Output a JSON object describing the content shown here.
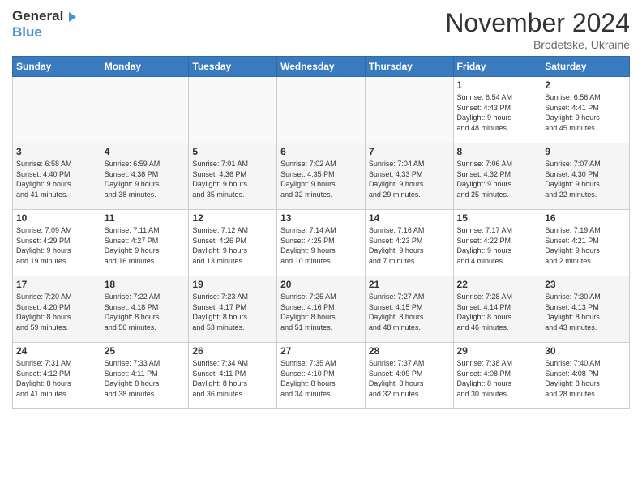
{
  "header": {
    "logo_line1": "General",
    "logo_line2": "Blue",
    "month_title": "November 2024",
    "location": "Brodetske, Ukraine"
  },
  "weekdays": [
    "Sunday",
    "Monday",
    "Tuesday",
    "Wednesday",
    "Thursday",
    "Friday",
    "Saturday"
  ],
  "weeks": [
    [
      {
        "day": "",
        "info": ""
      },
      {
        "day": "",
        "info": ""
      },
      {
        "day": "",
        "info": ""
      },
      {
        "day": "",
        "info": ""
      },
      {
        "day": "",
        "info": ""
      },
      {
        "day": "1",
        "info": "Sunrise: 6:54 AM\nSunset: 4:43 PM\nDaylight: 9 hours\nand 48 minutes."
      },
      {
        "day": "2",
        "info": "Sunrise: 6:56 AM\nSunset: 4:41 PM\nDaylight: 9 hours\nand 45 minutes."
      }
    ],
    [
      {
        "day": "3",
        "info": "Sunrise: 6:58 AM\nSunset: 4:40 PM\nDaylight: 9 hours\nand 41 minutes."
      },
      {
        "day": "4",
        "info": "Sunrise: 6:59 AM\nSunset: 4:38 PM\nDaylight: 9 hours\nand 38 minutes."
      },
      {
        "day": "5",
        "info": "Sunrise: 7:01 AM\nSunset: 4:36 PM\nDaylight: 9 hours\nand 35 minutes."
      },
      {
        "day": "6",
        "info": "Sunrise: 7:02 AM\nSunset: 4:35 PM\nDaylight: 9 hours\nand 32 minutes."
      },
      {
        "day": "7",
        "info": "Sunrise: 7:04 AM\nSunset: 4:33 PM\nDaylight: 9 hours\nand 29 minutes."
      },
      {
        "day": "8",
        "info": "Sunrise: 7:06 AM\nSunset: 4:32 PM\nDaylight: 9 hours\nand 25 minutes."
      },
      {
        "day": "9",
        "info": "Sunrise: 7:07 AM\nSunset: 4:30 PM\nDaylight: 9 hours\nand 22 minutes."
      }
    ],
    [
      {
        "day": "10",
        "info": "Sunrise: 7:09 AM\nSunset: 4:29 PM\nDaylight: 9 hours\nand 19 minutes."
      },
      {
        "day": "11",
        "info": "Sunrise: 7:11 AM\nSunset: 4:27 PM\nDaylight: 9 hours\nand 16 minutes."
      },
      {
        "day": "12",
        "info": "Sunrise: 7:12 AM\nSunset: 4:26 PM\nDaylight: 9 hours\nand 13 minutes."
      },
      {
        "day": "13",
        "info": "Sunrise: 7:14 AM\nSunset: 4:25 PM\nDaylight: 9 hours\nand 10 minutes."
      },
      {
        "day": "14",
        "info": "Sunrise: 7:16 AM\nSunset: 4:23 PM\nDaylight: 9 hours\nand 7 minutes."
      },
      {
        "day": "15",
        "info": "Sunrise: 7:17 AM\nSunset: 4:22 PM\nDaylight: 9 hours\nand 4 minutes."
      },
      {
        "day": "16",
        "info": "Sunrise: 7:19 AM\nSunset: 4:21 PM\nDaylight: 9 hours\nand 2 minutes."
      }
    ],
    [
      {
        "day": "17",
        "info": "Sunrise: 7:20 AM\nSunset: 4:20 PM\nDaylight: 8 hours\nand 59 minutes."
      },
      {
        "day": "18",
        "info": "Sunrise: 7:22 AM\nSunset: 4:18 PM\nDaylight: 8 hours\nand 56 minutes."
      },
      {
        "day": "19",
        "info": "Sunrise: 7:23 AM\nSunset: 4:17 PM\nDaylight: 8 hours\nand 53 minutes."
      },
      {
        "day": "20",
        "info": "Sunrise: 7:25 AM\nSunset: 4:16 PM\nDaylight: 8 hours\nand 51 minutes."
      },
      {
        "day": "21",
        "info": "Sunrise: 7:27 AM\nSunset: 4:15 PM\nDaylight: 8 hours\nand 48 minutes."
      },
      {
        "day": "22",
        "info": "Sunrise: 7:28 AM\nSunset: 4:14 PM\nDaylight: 8 hours\nand 46 minutes."
      },
      {
        "day": "23",
        "info": "Sunrise: 7:30 AM\nSunset: 4:13 PM\nDaylight: 8 hours\nand 43 minutes."
      }
    ],
    [
      {
        "day": "24",
        "info": "Sunrise: 7:31 AM\nSunset: 4:12 PM\nDaylight: 8 hours\nand 41 minutes."
      },
      {
        "day": "25",
        "info": "Sunrise: 7:33 AM\nSunset: 4:11 PM\nDaylight: 8 hours\nand 38 minutes."
      },
      {
        "day": "26",
        "info": "Sunrise: 7:34 AM\nSunset: 4:11 PM\nDaylight: 8 hours\nand 36 minutes."
      },
      {
        "day": "27",
        "info": "Sunrise: 7:35 AM\nSunset: 4:10 PM\nDaylight: 8 hours\nand 34 minutes."
      },
      {
        "day": "28",
        "info": "Sunrise: 7:37 AM\nSunset: 4:09 PM\nDaylight: 8 hours\nand 32 minutes."
      },
      {
        "day": "29",
        "info": "Sunrise: 7:38 AM\nSunset: 4:08 PM\nDaylight: 8 hours\nand 30 minutes."
      },
      {
        "day": "30",
        "info": "Sunrise: 7:40 AM\nSunset: 4:08 PM\nDaylight: 8 hours\nand 28 minutes."
      }
    ]
  ]
}
